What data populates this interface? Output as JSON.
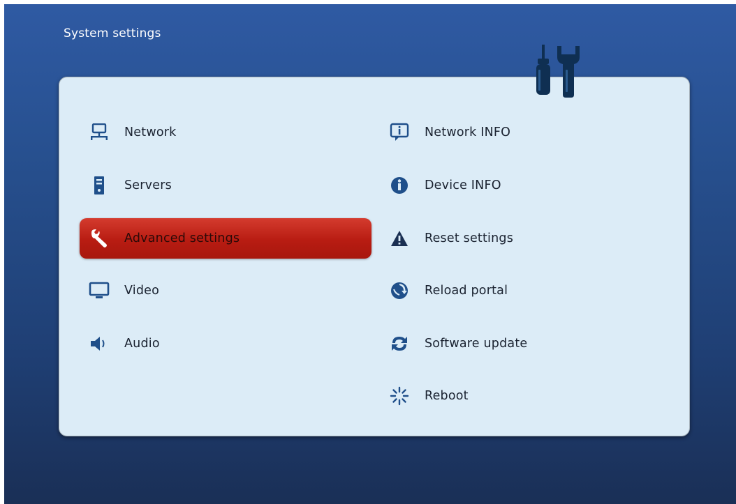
{
  "screen": {
    "title": "System settings"
  },
  "menu": {
    "left": [
      {
        "label": "Network",
        "icon": "network-icon"
      },
      {
        "label": "Servers",
        "icon": "server-icon"
      },
      {
        "label": "Advanced settings",
        "icon": "wrench-icon",
        "selected": true
      },
      {
        "label": "Video",
        "icon": "monitor-icon"
      },
      {
        "label": "Audio",
        "icon": "speaker-icon"
      }
    ],
    "right": [
      {
        "label": "Network INFO",
        "icon": "info-bubble-icon"
      },
      {
        "label": "Device INFO",
        "icon": "info-icon"
      },
      {
        "label": "Reset settings",
        "icon": "warning-icon"
      },
      {
        "label": "Reload portal",
        "icon": "reload-globe-icon"
      },
      {
        "label": "Software update",
        "icon": "refresh-icon"
      },
      {
        "label": "Reboot",
        "icon": "reboot-spinner-icon"
      }
    ]
  },
  "colors": {
    "selected": "#c0261a",
    "panel": "#dcecf7",
    "icon": "#1f4f8a"
  }
}
